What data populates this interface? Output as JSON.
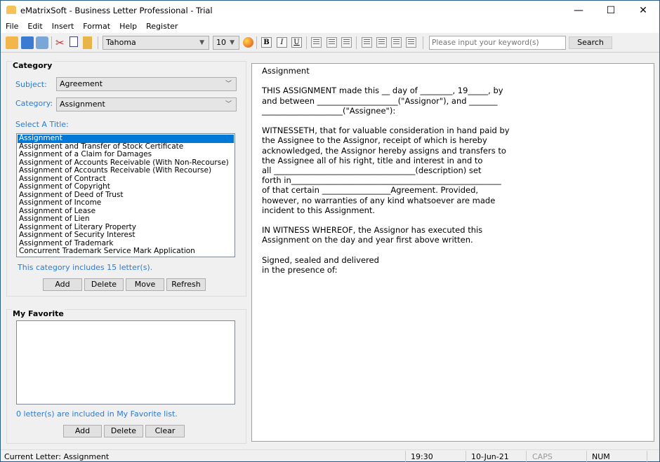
{
  "window": {
    "title": "eMatrixSoft - Business Letter Professional - Trial",
    "minimize": "—",
    "maximize": "☐",
    "close": "✕"
  },
  "menu": [
    "File",
    "Edit",
    "Insert",
    "Format",
    "Help",
    "Register"
  ],
  "toolbar": {
    "font": "Tahoma",
    "size": "10",
    "bold": "B",
    "italic": "I",
    "underline": "U",
    "search_placeholder": "Please input your keyword(s)",
    "search_value": "",
    "search_label": "Search"
  },
  "category": {
    "title": "Category",
    "subject_label": "Subject:",
    "subject_value": "Agreement",
    "category_label": "Category:",
    "category_value": "Assignment",
    "select_label": "Select A Title:",
    "titles": [
      "Assignment",
      "Assignment and Transfer of Stock Certificate",
      "Assignment of a Claim for Damages",
      "Assignment of Accounts Receivable (With Non-Recourse)",
      "Assignment of Accounts Receivable (With Recourse)",
      "Assignment of Contract",
      "Assignment of Copyright",
      "Assignment of Deed of Trust",
      "Assignment of Income",
      "Assignment of Lease",
      "Assignment of Lien",
      "Assignment of Literary Property",
      "Assignment of Security Interest",
      "Assignment of Trademark",
      "Concurrent Trademark Service Mark Application"
    ],
    "selected": "Assignment",
    "count_text": "This category includes 15 letter(s).",
    "buttons": [
      "Add",
      "Delete",
      "Move",
      "Refresh"
    ]
  },
  "favorite": {
    "title": "My Favorite",
    "count_text": "0 letter(s) are included in My Favorite list.",
    "buttons": [
      "Add",
      "Delete",
      "Clear"
    ]
  },
  "document": {
    "text": "Assignment\n\nTHIS ASSIGNMENT made this __ day of ________, 19_____, by\nand between ____________________(\"Assignor\"), and _______\n____________________(\"Assignee\"):\n\nWITNESSETH, that for valuable consideration in hand paid by\nthe Assignee to the Assignor, receipt of which is hereby\nacknowledged, the Assignor hereby assigns and transfers to\nthe Assignee all of his right, title and interest in and to\nall ___________________________________(description) set\nforth in____________________________________________________\nof that certain _________________Agreement. Provided,\nhowever, no warranties of any kind whatsoever are made\nincident to this Assignment.\n\nIN WITNESS WHEREOF, the Assignor has executed this\nAssignment on the day and year first above written.\n\nSigned, sealed and delivered\nin the presence of:"
  },
  "status": {
    "current": "Current Letter: Assignment",
    "time": "19:30",
    "date": "10-Jun-21",
    "caps": "CAPS",
    "num": "NUM"
  },
  "colors": {
    "accent": "#0078d7",
    "label_blue": "#2a7ad6"
  }
}
